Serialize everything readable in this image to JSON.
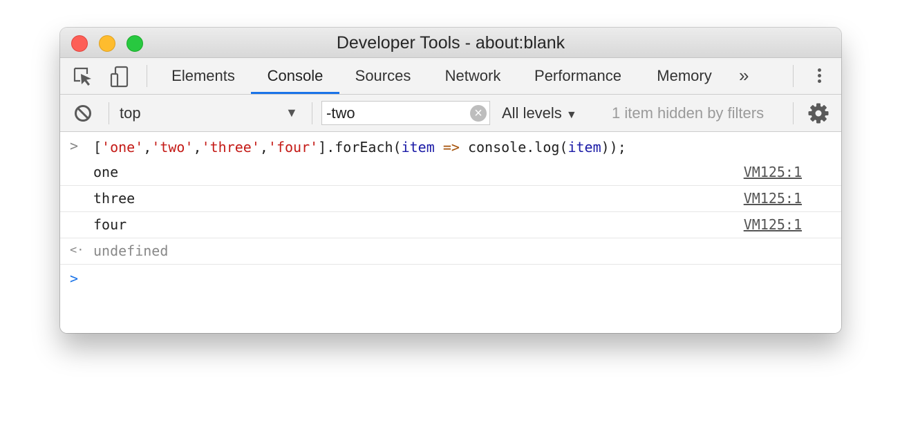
{
  "window": {
    "title": "Developer Tools - about:blank"
  },
  "toolbar": {
    "inspect_icon": "inspect-element-icon",
    "device_icon": "device-toolbar-icon",
    "tabs": [
      {
        "label": "Elements",
        "active": false
      },
      {
        "label": "Console",
        "active": true
      },
      {
        "label": "Sources",
        "active": false
      },
      {
        "label": "Network",
        "active": false
      },
      {
        "label": "Performance",
        "active": false
      },
      {
        "label": "Memory",
        "active": false
      }
    ],
    "more_tabs": "»",
    "menu_icon": "kebab-menu-icon",
    "accent_color": "#1a73e8"
  },
  "filterbar": {
    "clear_icon": "clear-console-icon",
    "context": "top",
    "filter_value": "-two",
    "levels": "All levels",
    "hidden_note": "1 item hidden by filters",
    "settings_icon": "gear-icon"
  },
  "console": {
    "input": {
      "prefix": ">",
      "tokens": [
        {
          "text": "[",
          "kind": "plain"
        },
        {
          "text": "'one'",
          "kind": "str"
        },
        {
          "text": ",",
          "kind": "plain"
        },
        {
          "text": "'two'",
          "kind": "str"
        },
        {
          "text": ",",
          "kind": "plain"
        },
        {
          "text": "'three'",
          "kind": "str"
        },
        {
          "text": ",",
          "kind": "plain"
        },
        {
          "text": "'four'",
          "kind": "str"
        },
        {
          "text": "].forEach(",
          "kind": "plain"
        },
        {
          "text": "item",
          "kind": "kw"
        },
        {
          "text": " ",
          "kind": "plain"
        },
        {
          "text": "=>",
          "kind": "op"
        },
        {
          "text": " console.log(",
          "kind": "plain"
        },
        {
          "text": "item",
          "kind": "kw"
        },
        {
          "text": "));",
          "kind": "plain"
        }
      ]
    },
    "logs": [
      {
        "text": "one",
        "source": "VM125:1"
      },
      {
        "text": "three",
        "source": "VM125:1"
      },
      {
        "text": "four",
        "source": "VM125:1"
      }
    ],
    "result": {
      "prefix": "<·",
      "text": "undefined"
    },
    "prompt": ">"
  }
}
